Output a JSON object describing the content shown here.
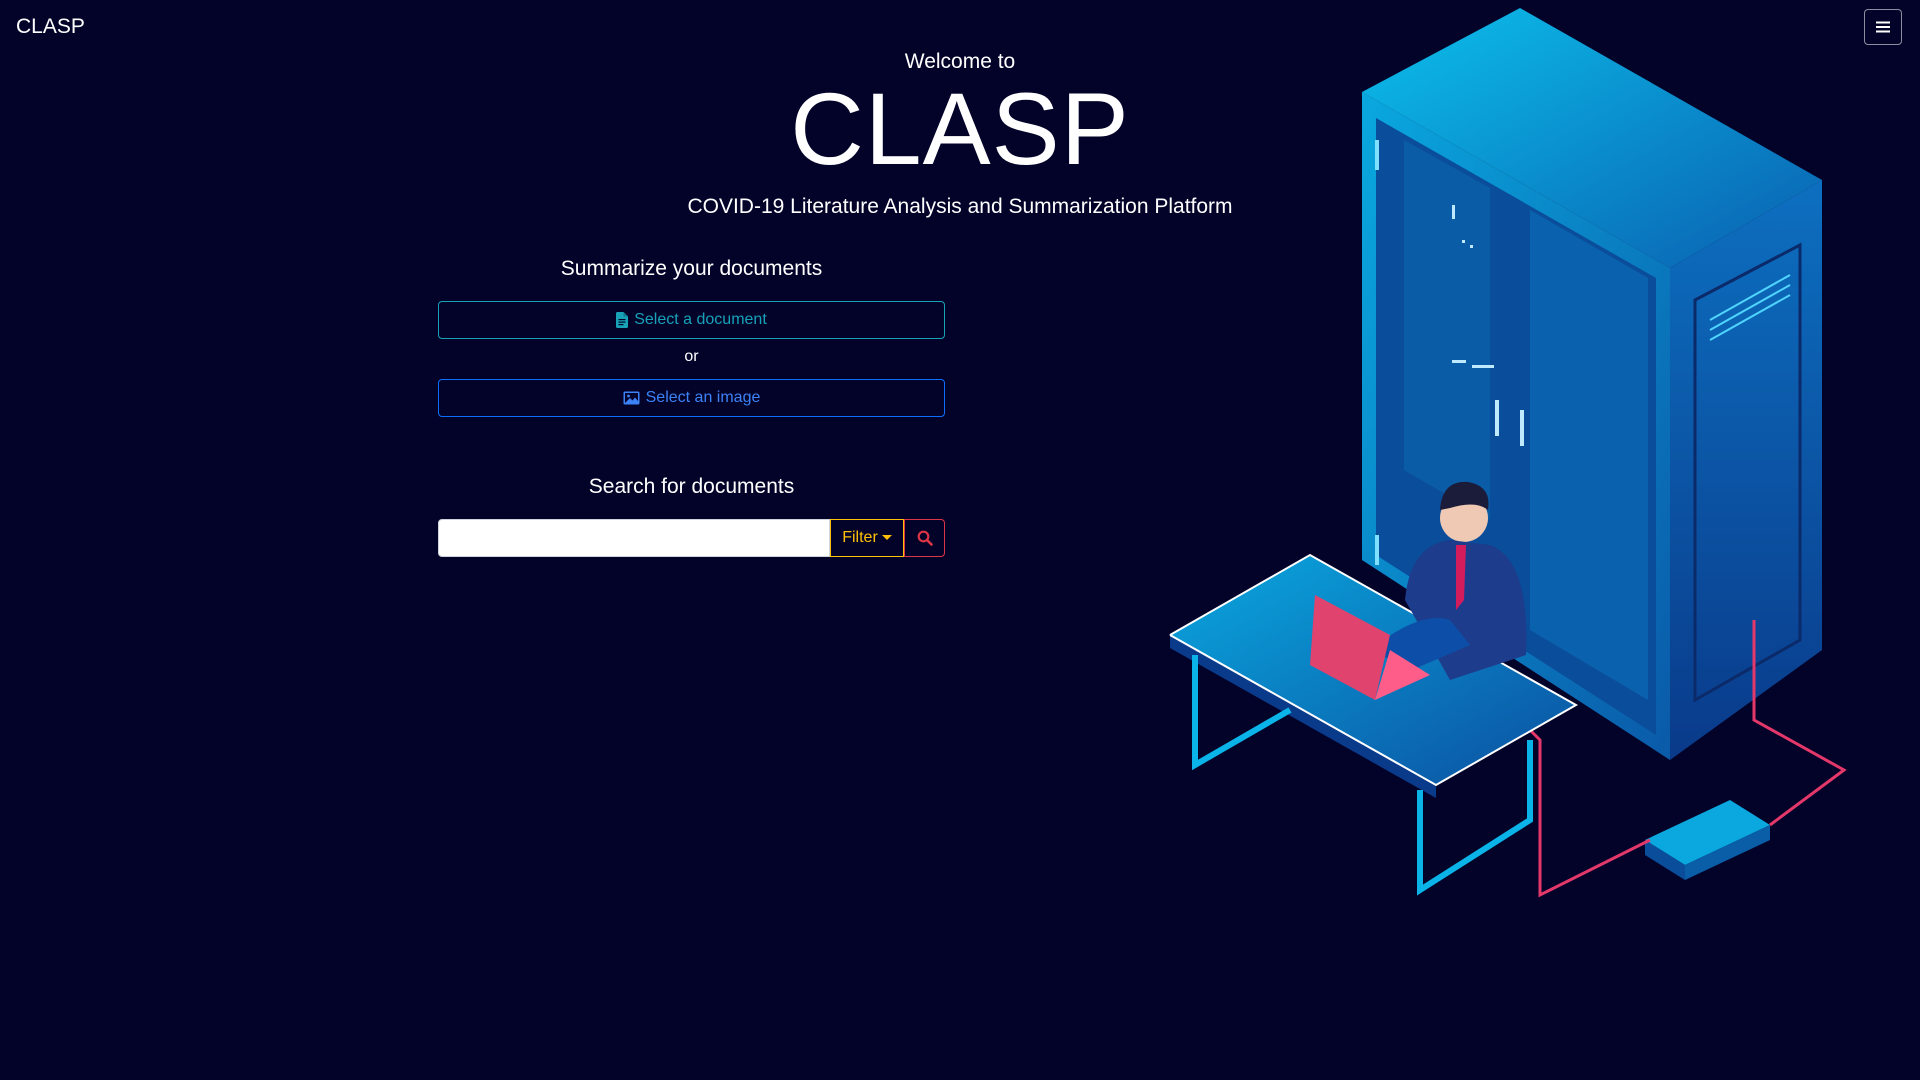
{
  "navbar": {
    "brand": "CLASP",
    "menu_icon": "hamburger-menu-icon"
  },
  "hero": {
    "welcome": "Welcome to",
    "title": "CLASP",
    "subtitle": "COVID-19 Literature Analysis and Summarization Platform"
  },
  "summarize": {
    "heading": "Summarize your documents",
    "document_button": {
      "label": "Select a document",
      "icon": "file-icon",
      "color": "#17a2b8"
    },
    "or_text": "or",
    "image_button": {
      "label": "Select an image",
      "icon": "image-icon",
      "color": "#0d6efd"
    }
  },
  "search": {
    "heading": "Search for documents",
    "input_value": "",
    "filter_label": "Filter",
    "filter_color": "#ffc107",
    "search_icon": "search-icon",
    "search_color": "#dc3545"
  },
  "illustration": {
    "icon": "server-room-illustration"
  },
  "colors": {
    "background": "#03032a",
    "text": "#ffffff"
  }
}
